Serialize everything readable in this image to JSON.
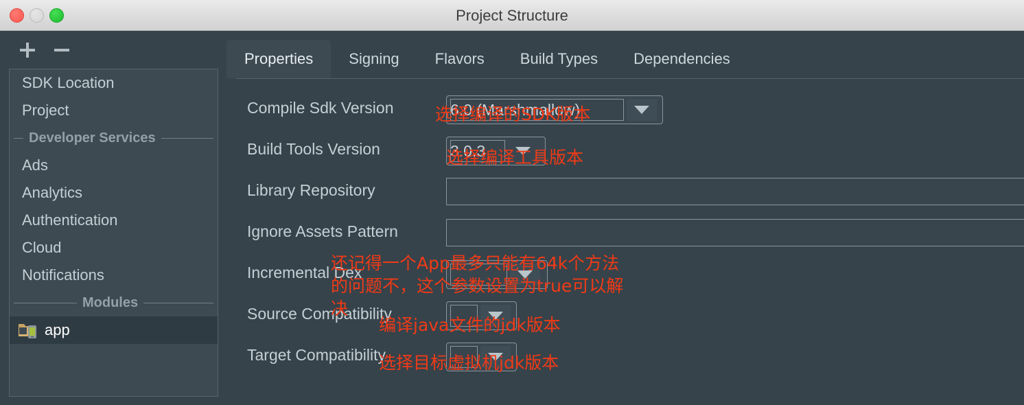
{
  "window": {
    "title": "Project Structure",
    "traffic_lights": [
      "close",
      "minimize",
      "maximize"
    ]
  },
  "sidebar": {
    "toolbar": {
      "add_label": "+",
      "remove_label": "−"
    },
    "items": [
      {
        "type": "item",
        "label": "SDK Location",
        "selected": false
      },
      {
        "type": "item",
        "label": "Project",
        "selected": false
      },
      {
        "type": "separator",
        "label": "Developer Services"
      },
      {
        "type": "item",
        "label": "Ads",
        "selected": false
      },
      {
        "type": "item",
        "label": "Analytics",
        "selected": false
      },
      {
        "type": "item",
        "label": "Authentication",
        "selected": false
      },
      {
        "type": "item",
        "label": "Cloud",
        "selected": false
      },
      {
        "type": "item",
        "label": "Notifications",
        "selected": false
      },
      {
        "type": "separator",
        "label": "Modules"
      },
      {
        "type": "module",
        "label": "app",
        "selected": true,
        "icon": "folder-module-icon"
      }
    ]
  },
  "tabs": [
    {
      "label": "Properties",
      "active": true
    },
    {
      "label": "Signing",
      "active": false
    },
    {
      "label": "Flavors",
      "active": false
    },
    {
      "label": "Build Types",
      "active": false
    },
    {
      "label": "Dependencies",
      "active": false
    }
  ],
  "form": {
    "rows": [
      {
        "label": "Compile Sdk Version",
        "control": "combo",
        "value": "6.0 (Marshmallow)"
      },
      {
        "label": "Build Tools Version",
        "control": "combo",
        "value": "3.0.3"
      },
      {
        "label": "Library Repository",
        "control": "text",
        "value": ""
      },
      {
        "label": "Ignore Assets Pattern",
        "control": "text",
        "value": ""
      },
      {
        "label": "Incremental Dex",
        "control": "combo",
        "value": ""
      },
      {
        "label": "Source Compatibility",
        "control": "combo",
        "value": ""
      },
      {
        "label": "Target Compatibility",
        "control": "combo",
        "value": ""
      }
    ]
  },
  "annotations": [
    {
      "id": "compile-sdk",
      "text": "选择编译的SDK版本"
    },
    {
      "id": "build-tools",
      "text": "选择编译工具版本"
    },
    {
      "id": "incremental-dex",
      "text": "还记得一个App最多只能有64k个方法\n的问题不，这个参数设置为true可以解\n决"
    },
    {
      "id": "source-compat",
      "text": "编译java文件的jdk版本"
    },
    {
      "id": "target-compat",
      "text": "选择目标虚拟机jdk版本"
    }
  ],
  "colors": {
    "window_bg": "#36434a",
    "panel_bg": "#3d4a52",
    "selected_row": "#2f3b42",
    "text": "#c5d0d6",
    "annotation": "#f03a17",
    "titlebar": "#dcdcdc"
  }
}
